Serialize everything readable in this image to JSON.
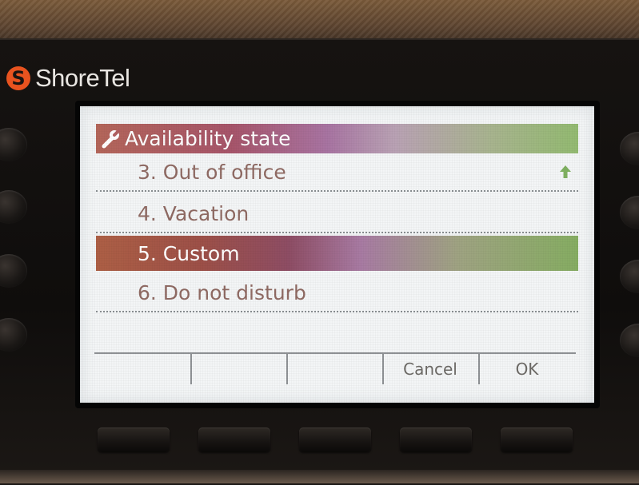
{
  "brand": {
    "logo_glyph": "S",
    "name": "ShoreTel",
    "logo_color": "#e8531f"
  },
  "screen": {
    "title": "Availability state",
    "title_icon": "wrench-icon",
    "scroll_indicator": "up-arrow-icon",
    "items": [
      {
        "label": "3.  Out of office",
        "selected": false
      },
      {
        "label": "4.  Vacation",
        "selected": false
      },
      {
        "label": "5.  Custom",
        "selected": true
      },
      {
        "label": "6.  Do not disturb",
        "selected": false
      }
    ],
    "softkeys": [
      "",
      "",
      "",
      "Cancel",
      "OK"
    ]
  },
  "colors": {
    "title_gradient_start": "#b4665a",
    "title_gradient_end": "#93ba71",
    "item_text": "#8f6a63",
    "screen_bg": "#f3f5f6"
  }
}
